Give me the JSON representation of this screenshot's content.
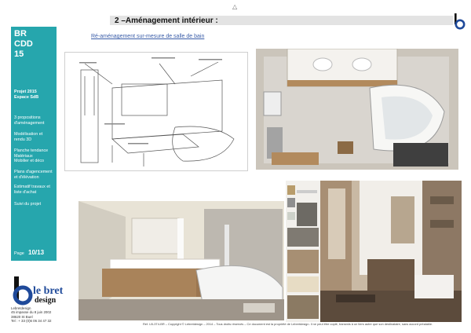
{
  "header": {
    "top_marker": "△",
    "section_title": "2 –Aménagement intérieur :",
    "subtitle": "Ré-aménagement sur-mesure de salle de bain"
  },
  "sidebar": {
    "code_lines": [
      "BR",
      "CDD",
      "15"
    ],
    "project": [
      "Projet 2015",
      "Espace SdB"
    ],
    "items": [
      [
        "3 propositions",
        "d'aménagement"
      ],
      [
        "Modélisation et",
        "rendu 3D"
      ],
      [
        "Planche tendance",
        "Matériaux",
        "Mobilier et déco"
      ],
      [
        "Plans d'agencement",
        "et d'élévation"
      ],
      [
        "Estimatif travaux et",
        "liste d'achat"
      ],
      [
        "Suivi du projet"
      ]
    ],
    "page_label": "Page",
    "page_number": "10/13"
  },
  "logo": {
    "text_top": "le bret",
    "text_bottom": "design"
  },
  "company": [
    "Lebretdesign",
    "45 impasse du 8 juin 2002",
    "38620 St Buel",
    "Tel : + 33 (0)6 06 34 47 32"
  ],
  "footer": "Ref. LB-3T4-BR – Copyright © Lebretdesign – 2014 – Tous droits réservés – Ce document est la propriété de Lebretdesign. Il ne peut être copié, transmis à un tiers autre que son destinataire, sans accord préalable.",
  "colors": {
    "sidebar": "#26a6ad",
    "subtitle": "#3a5da8",
    "logo_blue": "#1f4a9a"
  }
}
